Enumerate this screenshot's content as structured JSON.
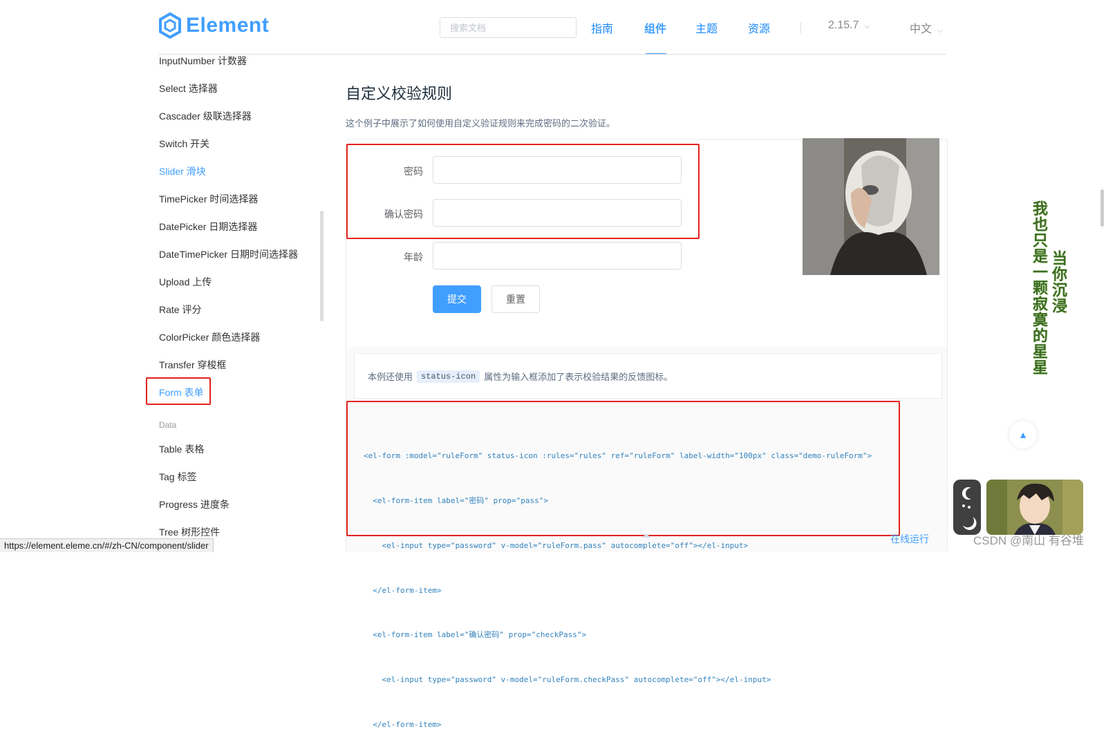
{
  "header": {
    "logo_text": "Element",
    "search_placeholder": "搜索文档",
    "nav": [
      "指南",
      "组件",
      "主题",
      "资源"
    ],
    "active_nav": "组件",
    "version": "2.15.7",
    "language": "中文"
  },
  "sidebar": {
    "items": [
      {
        "label": "InputNumber 计数器"
      },
      {
        "label": "Select 选择器"
      },
      {
        "label": "Cascader 级联选择器"
      },
      {
        "label": "Switch 开关"
      },
      {
        "label": "Slider 滑块"
      },
      {
        "label": "TimePicker 时间选择器"
      },
      {
        "label": "DatePicker 日期选择器"
      },
      {
        "label": "DateTimePicker 日期时间选择器"
      },
      {
        "label": "Upload 上传"
      },
      {
        "label": "Rate 评分"
      },
      {
        "label": "ColorPicker 颜色选择器"
      },
      {
        "label": "Transfer 穿梭框"
      },
      {
        "label": "Form 表单"
      }
    ],
    "group_data": "Data",
    "data_items": [
      {
        "label": "Table 表格"
      },
      {
        "label": "Tag 标签"
      },
      {
        "label": "Progress 进度条"
      },
      {
        "label": "Tree 树形控件"
      }
    ]
  },
  "content": {
    "title": "自定义校验规则",
    "description": "这个例子中展示了如何使用自定义验证规则来完成密码的二次验证。",
    "form": {
      "password_label": "密码",
      "confirm_label": "确认密码",
      "age_label": "年龄",
      "submit": "提交",
      "reset": "重置"
    },
    "meta_text_before": "本例还使用",
    "meta_code": "status-icon",
    "meta_text_after": "属性为输入框添加了表示校验结果的反馈图标。",
    "code_lines": [
      "<el-form :model=\"ruleForm\" status-icon :rules=\"rules\" ref=\"ruleForm\" label-width=\"100px\" class=\"demo-ruleForm\">",
      "  <el-form-item label=\"密码\" prop=\"pass\">",
      "    <el-input type=\"password\" v-model=\"ruleForm.pass\" autocomplete=\"off\"></el-input>",
      "  </el-form-item>",
      "  <el-form-item label=\"确认密码\" prop=\"checkPass\">",
      "    <el-input type=\"password\" v-model=\"ruleForm.checkPass\" autocomplete=\"off\"></el-input>",
      "  </el-form-item>"
    ],
    "run_online": "在线运行"
  },
  "overlay": {
    "vertical_text_1": "我也只是一颗寂寞的星星",
    "vertical_text_2": "当你沉浸",
    "watermark": "CSDN @南山 有谷堆",
    "status_url": "https://element.eleme.cn/#/zh-CN/component/slider"
  },
  "colors": {
    "brand": "#409EFF",
    "annotation_red": "#e4211c"
  }
}
